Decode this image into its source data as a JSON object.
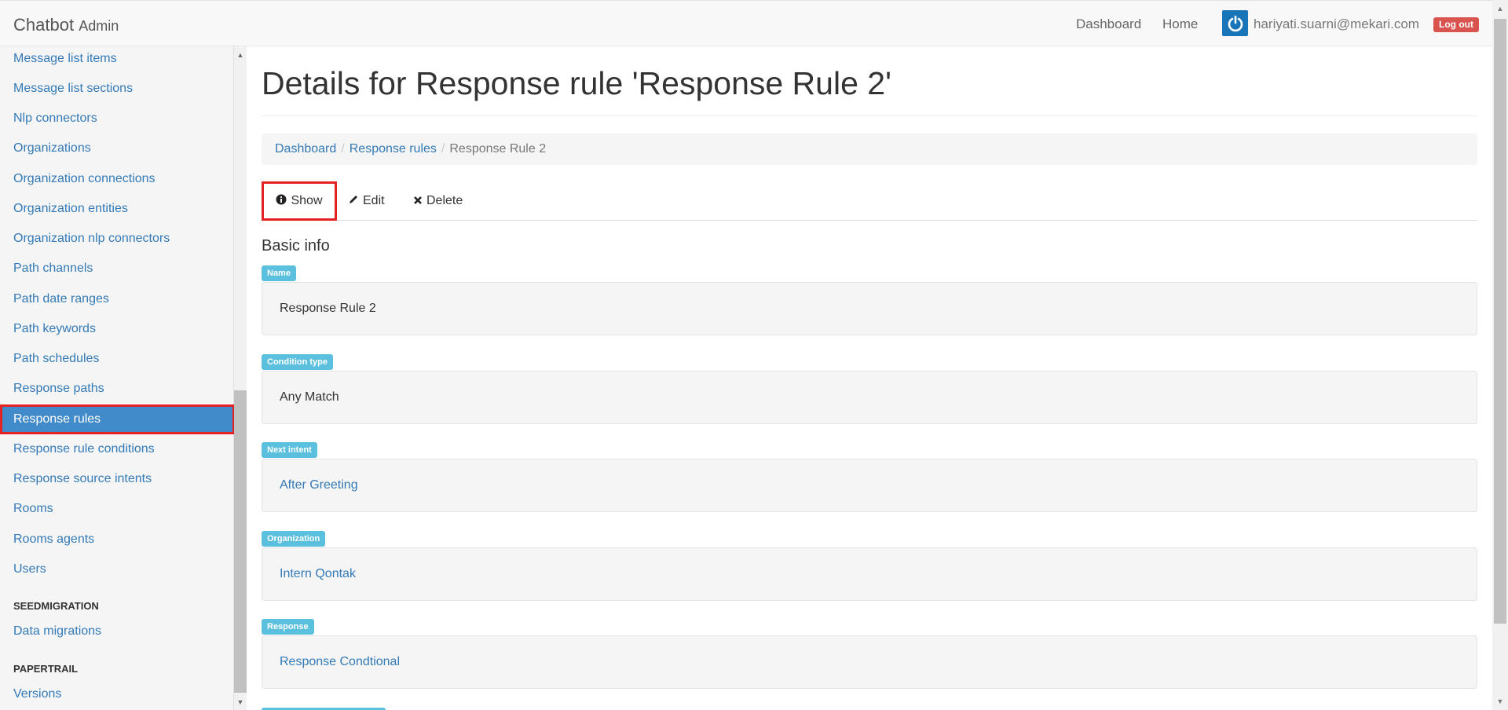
{
  "navbar": {
    "brand": "Chatbot",
    "brand_sub": "Admin",
    "links": [
      "Dashboard",
      "Home"
    ],
    "user_email": "hariyati.suarni@mekari.com",
    "logout_label": "Log out"
  },
  "sidebar": {
    "items": [
      {
        "label": "Message list items"
      },
      {
        "label": "Message list sections"
      },
      {
        "label": "Nlp connectors"
      },
      {
        "label": "Organizations"
      },
      {
        "label": "Organization connections"
      },
      {
        "label": "Organization entities"
      },
      {
        "label": "Organization nlp connectors"
      },
      {
        "label": "Path channels"
      },
      {
        "label": "Path date ranges"
      },
      {
        "label": "Path keywords"
      },
      {
        "label": "Path schedules"
      },
      {
        "label": "Response paths"
      },
      {
        "label": "Response rules",
        "active": true
      },
      {
        "label": "Response rule conditions"
      },
      {
        "label": "Response source intents"
      },
      {
        "label": "Rooms"
      },
      {
        "label": "Rooms agents"
      },
      {
        "label": "Users"
      }
    ],
    "section_seedmigration": "SEEDMIGRATION",
    "data_migrations": "Data migrations",
    "section_papertrail": "PAPERTRAIL",
    "versions": "Versions"
  },
  "main": {
    "title": "Details for Response rule 'Response Rule 2'",
    "breadcrumb": {
      "items": [
        "Dashboard",
        "Response rules"
      ],
      "current": "Response Rule 2"
    },
    "tabs": {
      "show": "Show",
      "edit": "Edit",
      "delete": "Delete"
    },
    "section_title": "Basic info",
    "fields": [
      {
        "label": "Name",
        "value": "Response Rule 2",
        "link": false
      },
      {
        "label": "Condition type",
        "value": "Any Match",
        "link": false
      },
      {
        "label": "Next intent",
        "value": "After Greeting",
        "link": true
      },
      {
        "label": "Organization",
        "value": "Intern Qontak",
        "link": true
      },
      {
        "label": "Response",
        "value": "Response Condtional",
        "link": true
      }
    ]
  },
  "colors": {
    "link": "#337ab7",
    "active_sidebar": "#428bca",
    "label_badge": "#5bc0de",
    "logout": "#d9534f",
    "highlight": "#e52222"
  }
}
